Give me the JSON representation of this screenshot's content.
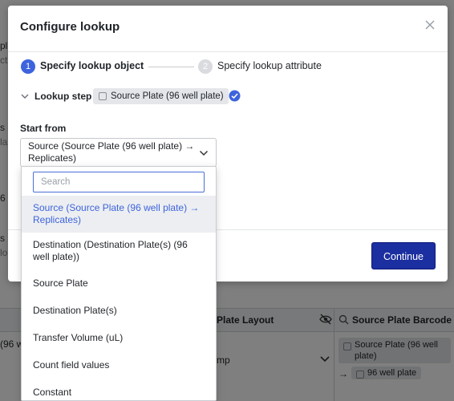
{
  "background": {
    "fragments": [
      "pl",
      "ct",
      "s a",
      "la",
      "6",
      "s",
      "lo",
      "(96 w",
      "mp"
    ],
    "table": {
      "col_plate_layout": "Plate Layout",
      "col_source_barcode": "Source Plate Barcode",
      "chip_source": "Source Plate (96 well plate)",
      "chip_arrow": "→",
      "chip_96": "96 well plate"
    }
  },
  "modal": {
    "title": "Configure lookup",
    "steps": [
      {
        "number": "1",
        "label": "Specify lookup object",
        "active": true
      },
      {
        "number": "2",
        "label": "Specify lookup attribute",
        "active": false
      }
    ],
    "lookup_step_label": "Lookup step",
    "lookup_object_chip": "Source Plate (96 well plate)",
    "start_from_label": "Start from",
    "start_from_value": "Source (Source Plate (96 well plate) → Replicates)",
    "continue_label": "Continue",
    "accent_color": "#3d63dd",
    "primary_button_color": "#1c2fa0"
  },
  "dropdown": {
    "search_placeholder": "Search",
    "options": [
      "Source (Source Plate (96 well plate) → Replicates)",
      "Destination (Destination Plate(s) (96 well plate))",
      "Source Plate",
      "Destination Plate(s)",
      "Transfer Volume (uL)",
      "Count field values",
      "Constant"
    ],
    "selected_index": 0
  }
}
